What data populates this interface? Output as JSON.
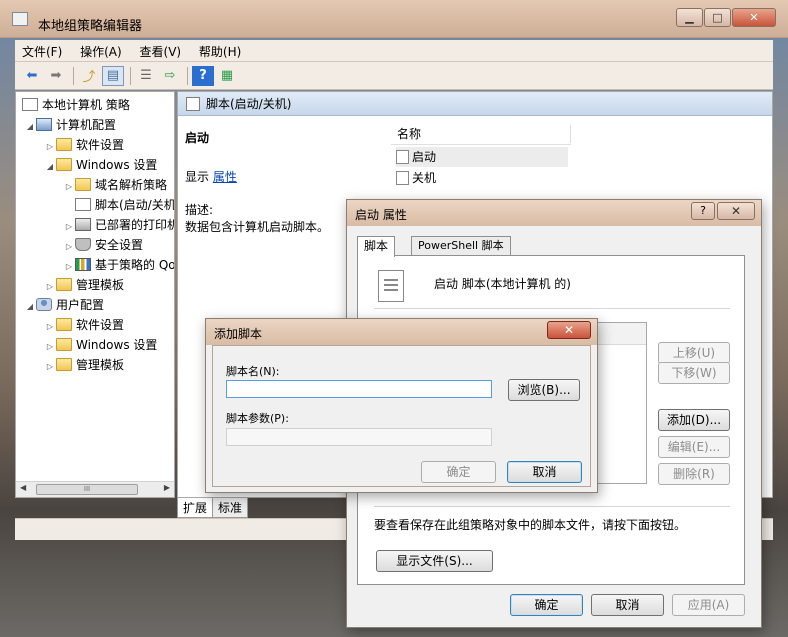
{
  "window": {
    "title": "本地组策略编辑器"
  },
  "menu": [
    "文件(F)",
    "操作(A)",
    "查看(V)",
    "帮助(H)"
  ],
  "tree": {
    "items": [
      {
        "label": "本地计算机 策略",
        "icon": "policy-icon"
      },
      {
        "label": "计算机配置",
        "icon": "computer-icon"
      },
      {
        "label": "软件设置",
        "icon": "folder-icon"
      },
      {
        "label": "Windows 设置",
        "icon": "folder-icon"
      },
      {
        "label": "域名解析策略",
        "icon": "folder-icon"
      },
      {
        "label": "脚本(启动/关机)",
        "icon": "script-icon"
      },
      {
        "label": "已部署的打印机",
        "icon": "printer-icon"
      },
      {
        "label": "安全设置",
        "icon": "shield-icon"
      },
      {
        "label": "基于策略的 QoS",
        "icon": "chart-icon"
      },
      {
        "label": "管理模板",
        "icon": "folder-icon"
      },
      {
        "label": "用户配置",
        "icon": "user-icon"
      },
      {
        "label": "软件设置",
        "icon": "folder-icon"
      },
      {
        "label": "Windows 设置",
        "icon": "folder-icon"
      },
      {
        "label": "管理模板",
        "icon": "folder-icon"
      }
    ],
    "hscroll_thumb": "III"
  },
  "content": {
    "header": "脚本(启动/关机)",
    "detail_title": "启动",
    "display_label": "显示",
    "properties_link": "属性",
    "desc_label": "描述:",
    "desc_text": "数据包含计算机启动脚本。",
    "column_name": "名称",
    "rows": [
      "启动",
      "关机"
    ]
  },
  "bottom_tabs": [
    "扩展",
    "标准"
  ],
  "prop_dialog": {
    "title": "启动 属性",
    "help": "?",
    "tabs": [
      "脚本",
      "PowerShell 脚本"
    ],
    "heading": "启动 脚本(本地计算机 的)",
    "list_header_partial": "名称",
    "buttons": {
      "up": "上移(U)",
      "down": "下移(W)",
      "add": "添加(D)...",
      "edit": "编辑(E)...",
      "remove": "删除(R)",
      "show_files": "显示文件(S)...",
      "ok": "确定",
      "cancel": "取消",
      "apply": "应用(A)"
    },
    "hint": "要查看保存在此组策略对象中的脚本文件，请按下面按钮。"
  },
  "add_dialog": {
    "title": "添加脚本",
    "script_name_label": "脚本名(N):",
    "script_name_value": "",
    "browse": "浏览(B)...",
    "params_label": "脚本参数(P):",
    "params_value": "",
    "ok": "确定",
    "cancel": "取消"
  },
  "colors": {
    "accent": "#3c7fb1",
    "link": "#0645ad",
    "title_bar": "#d9bca4"
  }
}
